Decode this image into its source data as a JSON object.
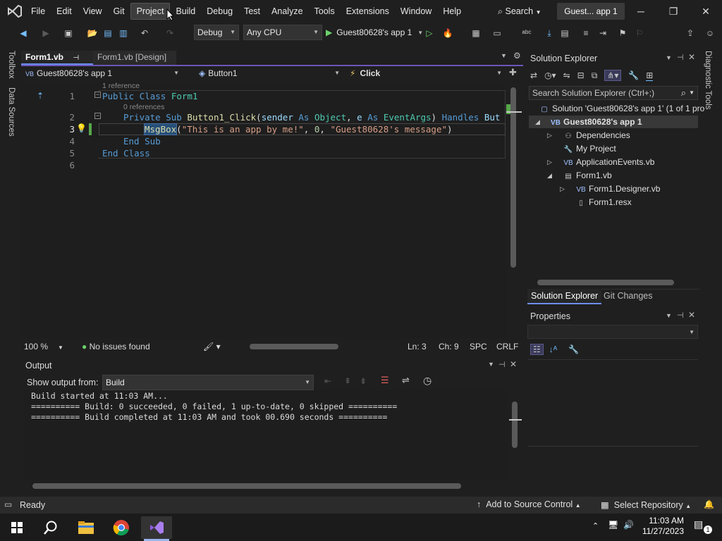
{
  "menu": {
    "items": [
      "File",
      "Edit",
      "View",
      "Git",
      "Project",
      "Build",
      "Debug",
      "Test",
      "Analyze",
      "Tools",
      "Extensions",
      "Window",
      "Help"
    ],
    "search_label": "Search",
    "solution_badge": "Guest... app 1"
  },
  "toolbar": {
    "configuration": "Debug",
    "platform": "Any CPU",
    "run_target": "Guest80628's app 1"
  },
  "side_tabs": {
    "toolbox": "Toolbox",
    "data_sources": "Data Sources",
    "diagnostic": "Diagnostic Tools"
  },
  "editor": {
    "tabs": [
      {
        "label": "Form1.vb",
        "active": true
      },
      {
        "label": "Form1.vb [Design]",
        "active": false
      }
    ],
    "nav": {
      "project": "Guest80628's app 1",
      "object": "Button1",
      "event": "Click"
    },
    "ref1": "1 reference",
    "ref2": "0 references",
    "line_numbers": [
      "1",
      "2",
      "3",
      "4",
      "5",
      "6"
    ],
    "code": {
      "l1_kw": "Public Class ",
      "l1_ty": "Form1",
      "l2_kw1": "Private Sub ",
      "l2_fn": "Button1_Click",
      "l2_p1": "(",
      "l2_id1": "sender",
      "l2_kw2": " As ",
      "l2_ty1": "Object",
      "l2_p2": ", ",
      "l2_id2": "e",
      "l2_kw3": " As ",
      "l2_ty2": "EventArgs",
      "l2_p3": ") ",
      "l2_kw4": "Handles ",
      "l2_id3": "But",
      "l3_fn": "MsgBox",
      "l3_p1": "(",
      "l3_st1": "\"This is an app by me!\"",
      "l3_p2": ", ",
      "l3_nm": "0",
      "l3_p3": ", ",
      "l3_st2": "\"Guest80628's message\"",
      "l3_p4": ")",
      "l4": "End Sub",
      "l5": "End Class"
    },
    "status": {
      "zoom": "100 %",
      "issues": "No issues found",
      "ln": "Ln: 3",
      "ch": "Ch: 9",
      "spc": "SPC",
      "eol": "CRLF"
    }
  },
  "output": {
    "title": "Output",
    "show_from_label": "Show output from:",
    "source": "Build",
    "lines": [
      "Build started at 11:03 AM...",
      "========== Build: 0 succeeded, 0 failed, 1 up-to-date, 0 skipped ==========",
      "========== Build completed at 11:03 AM and took 00.690 seconds =========="
    ]
  },
  "solution_explorer": {
    "title": "Solution Explorer",
    "search_placeholder": "Search Solution Explorer (Ctrl+;)",
    "solution": "Solution 'Guest80628's app 1' (1 of 1 pro",
    "project": "Guest80628's app 1",
    "items": [
      "Dependencies",
      "My Project",
      "ApplicationEvents.vb",
      "Form1.vb",
      "Form1.Designer.vb",
      "Form1.resx"
    ],
    "tabs": [
      "Solution Explorer",
      "Git Changes"
    ]
  },
  "properties": {
    "title": "Properties"
  },
  "statusbar": {
    "ready": "Ready",
    "source_control": "Add to Source Control",
    "repository": "Select Repository"
  },
  "taskbar": {
    "time": "11:03 AM",
    "date": "11/27/2023",
    "notifications": "1"
  }
}
